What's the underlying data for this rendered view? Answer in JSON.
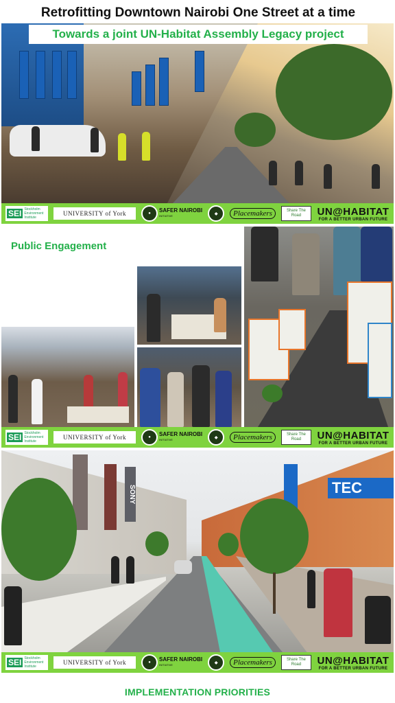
{
  "header": {
    "title": "Retrofitting Downtown Nairobi One Street at a time",
    "subtitle": "Towards a joint UN-Habitat Assembly Legacy project"
  },
  "logos": {
    "sei_mark": "SEI",
    "sei_text": "Stockholm Environment Institute",
    "york": "UNIVERSITY of York",
    "safer_main": "SAFER NAIROBI",
    "safer_sub": "INITIATIVE",
    "placemakers": "Placemakers",
    "share_the_road": "Share The Road",
    "unhabitat_main": "UN@HABITAT",
    "unhabitat_sub": "FOR A BETTER URBAN FUTURE"
  },
  "section": {
    "public_engagement": "Public Engagement",
    "implementation": "IMPLEMENTATION PRIORITIES"
  },
  "signage": {
    "tecno": "TEC",
    "sony": "SONY"
  },
  "colors": {
    "accent_green": "#23b04a",
    "logo_bar": "#7fd33f",
    "tecno_blue": "#1b69c6",
    "cycle_lane": "#56c9b1"
  }
}
